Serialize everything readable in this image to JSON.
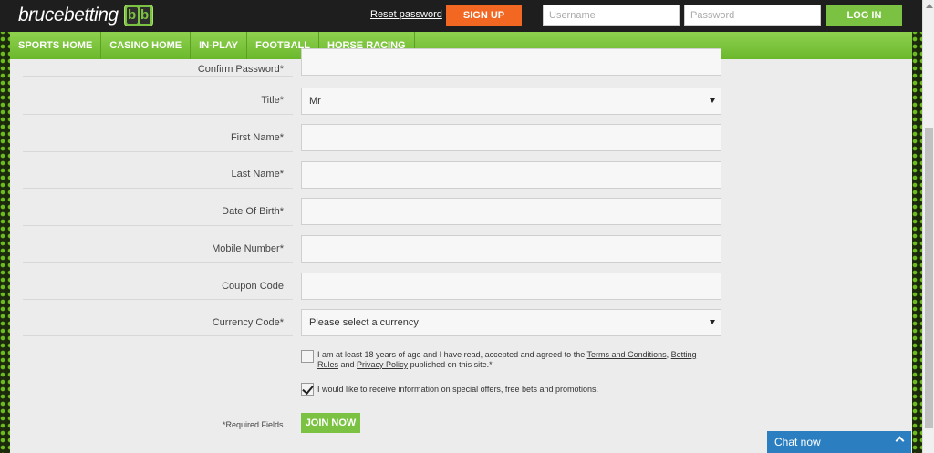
{
  "brand": {
    "name": "brucebetting",
    "badge": [
      "b",
      "b"
    ]
  },
  "header": {
    "reset_password": "Reset password",
    "signup": "SIGN UP",
    "username_placeholder": "Username",
    "password_placeholder": "Password",
    "login": "LOG IN"
  },
  "nav": [
    {
      "label": "SPORTS HOME"
    },
    {
      "label": "CASINO HOME"
    },
    {
      "label": "IN-PLAY"
    },
    {
      "label": "FOOTBALL"
    },
    {
      "label": "HORSE RACING"
    }
  ],
  "form": {
    "confirm_password": {
      "label": "Confirm Password*",
      "value": ""
    },
    "title": {
      "label": "Title*",
      "value": "Mr"
    },
    "first_name": {
      "label": "First Name*",
      "value": ""
    },
    "last_name": {
      "label": "Last Name*",
      "value": ""
    },
    "dob": {
      "label": "Date Of Birth*",
      "value": ""
    },
    "mobile": {
      "label": "Mobile Number*",
      "value": ""
    },
    "coupon": {
      "label": "Coupon Code",
      "value": ""
    },
    "currency": {
      "label": "Currency Code*",
      "value": "Please select a currency"
    },
    "terms": {
      "checked": false,
      "text_before": "I am at least 18 years of age and I have read, accepted and agreed to the ",
      "link1": "Terms and Conditions",
      "sep": ", ",
      "link2": "Betting Rules",
      "and": " and ",
      "link3": "Privacy Policy",
      "text_after": " published on this site.*"
    },
    "offers": {
      "checked": true,
      "text": "I would like to receive information on special offers, free bets and promotions."
    },
    "required_note": "*Required Fields",
    "join": "JOIN NOW"
  },
  "chat": {
    "label": "Chat now"
  },
  "colors": {
    "accent_green": "#7cc242",
    "signup_orange": "#f26722",
    "chat_blue": "#2b7fc1"
  }
}
